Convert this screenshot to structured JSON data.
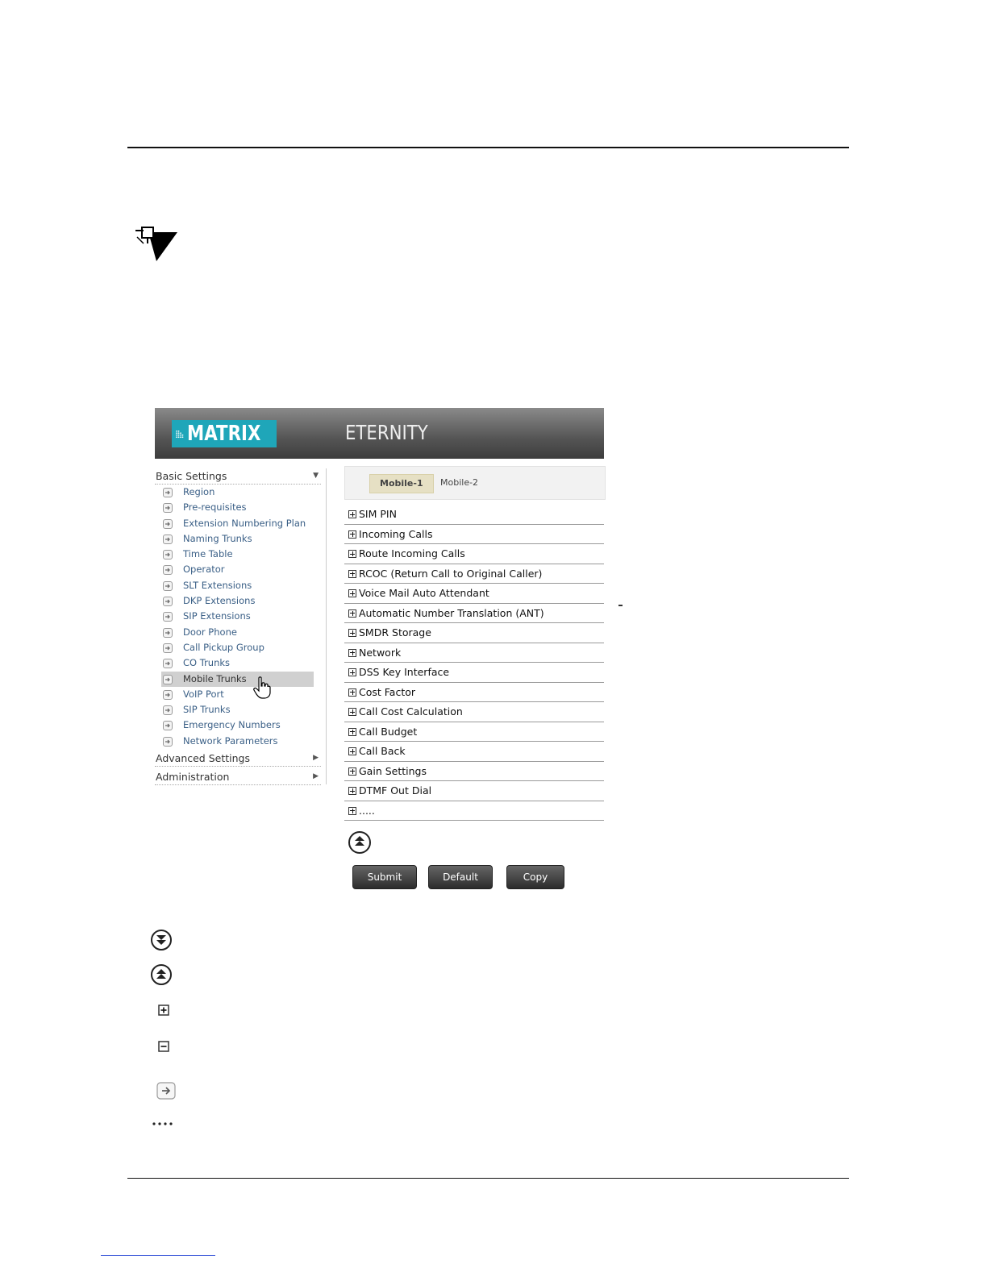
{
  "header": {
    "brand": "MATRIX",
    "product": "ETERNITY"
  },
  "sidebar": {
    "sections": [
      {
        "title": "Basic Settings",
        "expanded": true
      },
      {
        "title": "Advanced Settings",
        "expanded": false
      },
      {
        "title": "Administration",
        "expanded": false
      }
    ],
    "items": [
      "Region",
      "Pre-requisites",
      "Extension Numbering Plan",
      "Naming Trunks",
      "Time Table",
      "Operator",
      "SLT Extensions",
      "DKP Extensions",
      "SIP Extensions",
      "Door Phone",
      "Call Pickup Group",
      "CO Trunks",
      "Mobile Trunks",
      "VoIP Port",
      "SIP Trunks",
      "Emergency Numbers",
      "Network Parameters"
    ],
    "active_item": "Mobile Trunks"
  },
  "tabs": [
    {
      "label": "Mobile-1",
      "selected": true
    },
    {
      "label": "Mobile-2",
      "selected": false
    }
  ],
  "settings": [
    "SIM PIN",
    "Incoming Calls",
    "Route Incoming Calls",
    "RCOC (Return Call to Original Caller)",
    "Voice Mail Auto Attendant",
    "Automatic Number Translation (ANT)",
    "SMDR Storage",
    "Network",
    "DSS Key Interface",
    "Cost Factor",
    "Call Cost Calculation",
    "Call Budget",
    "Call Back",
    "Gain Settings",
    "DTMF Out Dial",
    "....."
  ],
  "buttons": {
    "submit": "Submit",
    "default": "Default",
    "copy": "Copy"
  },
  "icons": {
    "note": "note-pin-icon",
    "collapse_all": "collapse-all-icon",
    "expand_all": "expand-all-icon",
    "plus": "plus-box-icon",
    "minus": "minus-box-icon",
    "arrow": "arrow-right-box-icon",
    "ellipsis": "ellipsis-icon"
  },
  "colors": {
    "brand": "#1fa6b9",
    "link": "#3a5f86",
    "tab_selected": "#e6e0c4"
  }
}
